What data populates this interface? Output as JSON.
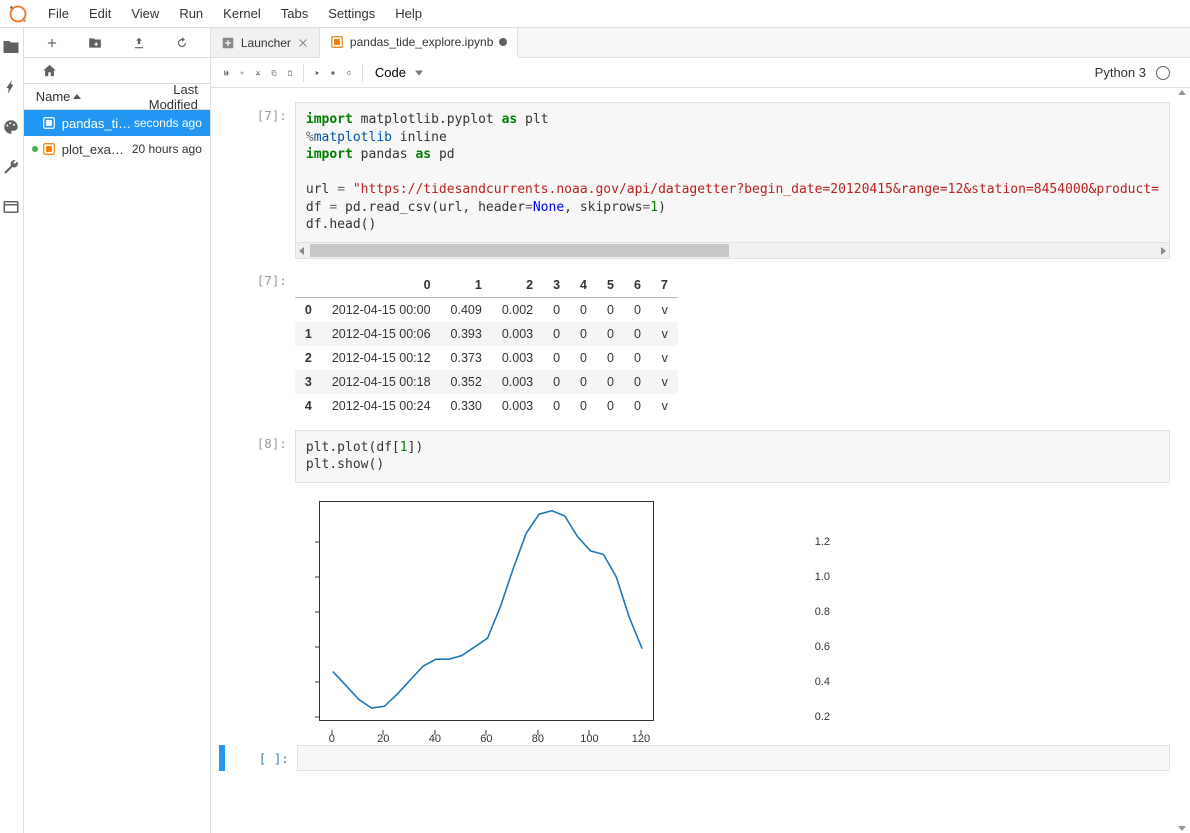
{
  "menu": [
    "File",
    "Edit",
    "View",
    "Run",
    "Kernel",
    "Tabs",
    "Settings",
    "Help"
  ],
  "file_panel": {
    "headers": {
      "name": "Name",
      "modified": "Last Modified"
    },
    "files": [
      {
        "name": "pandas_tide...",
        "modified": "seconds ago",
        "selected": true,
        "running": false,
        "color": "#fff"
      },
      {
        "name": "plot_exampl...",
        "modified": "20 hours ago",
        "selected": false,
        "running": true,
        "color": "#f57c00"
      }
    ]
  },
  "tabs": [
    {
      "label": "Launcher",
      "icon": "launcher",
      "active": false,
      "closable": true,
      "dirty": false
    },
    {
      "label": "pandas_tide_explore.ipynb",
      "icon": "notebook",
      "active": true,
      "closable": false,
      "dirty": true
    }
  ],
  "toolbar": {
    "celltype": "Code"
  },
  "kernel": {
    "name": "Python 3"
  },
  "cells": [
    {
      "prompt": "[7]:",
      "code_html": "<span class='kw-g'>import</span> matplotlib.pyplot <span class='kw-g'>as</span> plt\n<span class='op'>%</span><span class='fn'>matplotlib</span> inline\n<span class='kw-g'>import</span> pandas <span class='kw-g'>as</span> pd\n\nurl <span class='op'>=</span> <span class='str'>\"https://tidesandcurrents.noaa.gov/api/datagetter?begin_date=20120415&amp;range=12&amp;station=8454000&amp;product=</span>\ndf <span class='op'>=</span> pd.read_csv(url, header<span class='op'>=</span><span class='kw-b'>None</span>, skiprows<span class='op'>=</span><span class='num'>1</span>)\ndf.head()",
      "has_hscroll": true
    },
    {
      "prompt": "[8]:",
      "code_html": "plt.plot(df[<span class='num'>1</span>])\nplt.show()"
    }
  ],
  "output_table": {
    "prompt": "[7]:",
    "columns": [
      "",
      "0",
      "1",
      "2",
      "3",
      "4",
      "5",
      "6",
      "7"
    ],
    "rows": [
      [
        "0",
        "2012-04-15 00:00",
        "0.409",
        "0.002",
        "0",
        "0",
        "0",
        "0",
        "v"
      ],
      [
        "1",
        "2012-04-15 00:06",
        "0.393",
        "0.003",
        "0",
        "0",
        "0",
        "0",
        "v"
      ],
      [
        "2",
        "2012-04-15 00:12",
        "0.373",
        "0.003",
        "0",
        "0",
        "0",
        "0",
        "v"
      ],
      [
        "3",
        "2012-04-15 00:18",
        "0.352",
        "0.003",
        "0",
        "0",
        "0",
        "0",
        "v"
      ],
      [
        "4",
        "2012-04-15 00:24",
        "0.330",
        "0.003",
        "0",
        "0",
        "0",
        "0",
        "v"
      ]
    ]
  },
  "chart_data": {
    "type": "line",
    "xlabel": "",
    "ylabel": "",
    "x_ticks": [
      0,
      20,
      40,
      60,
      80,
      100,
      120
    ],
    "y_ticks": [
      0.2,
      0.4,
      0.6,
      0.8,
      1.0,
      1.2
    ],
    "xlim": [
      -5,
      125
    ],
    "ylim": [
      0.12,
      1.38
    ],
    "series": [
      {
        "name": "df[1]",
        "color": "#1f77b4",
        "x": [
          0,
          5,
          10,
          15,
          20,
          25,
          30,
          35,
          40,
          45,
          50,
          55,
          60,
          65,
          70,
          75,
          80,
          85,
          90,
          95,
          100,
          105,
          110,
          115,
          120
        ],
        "y": [
          0.409,
          0.33,
          0.25,
          0.2,
          0.21,
          0.28,
          0.36,
          0.44,
          0.48,
          0.48,
          0.5,
          0.55,
          0.6,
          0.78,
          1.0,
          1.2,
          1.31,
          1.33,
          1.3,
          1.18,
          1.1,
          1.08,
          0.95,
          0.72,
          0.54
        ]
      }
    ]
  },
  "empty_cell_prompt": "[ ]:"
}
